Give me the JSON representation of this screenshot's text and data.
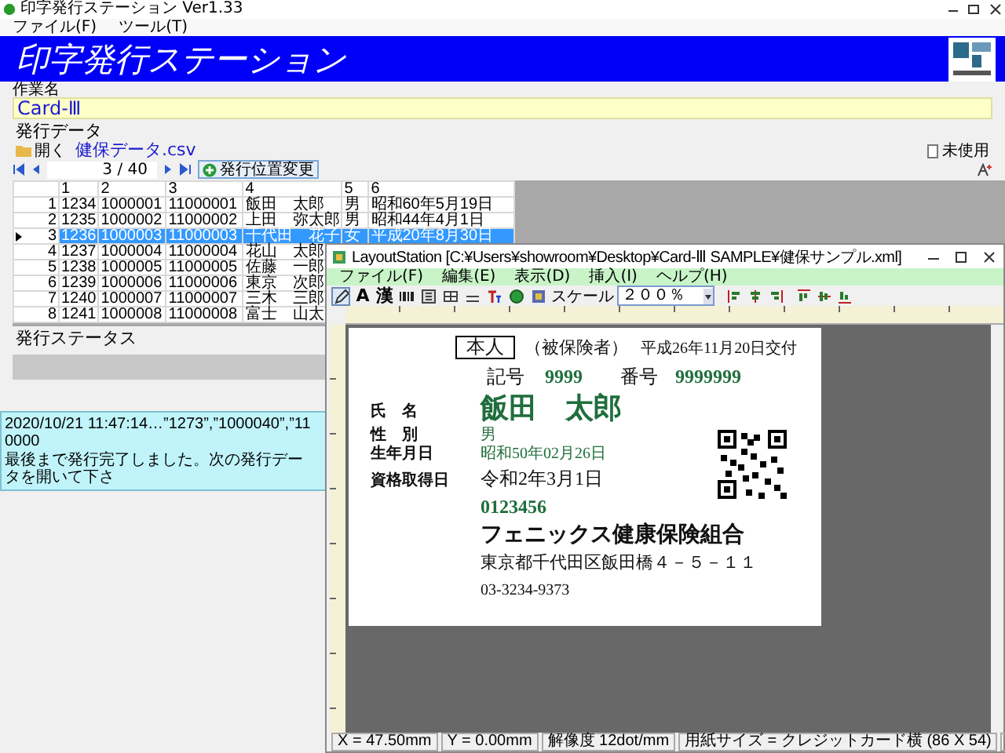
{
  "main_window": {
    "title": "印字発行ステーション Ver1.33",
    "menu": [
      "ファイル(F)",
      "ツール(T)"
    ],
    "banner_title": "印字発行ステーション",
    "job_name": {
      "label": "作業名",
      "value": "Card-Ⅲ"
    },
    "issue_data": {
      "heading": "発行データ",
      "open_button": "開く",
      "file_name": "健保データ.csv",
      "unused_button": "未使用",
      "position": "3 / 40",
      "change_position_button": "発行位置変更"
    },
    "table": {
      "columns": [
        "1",
        "2",
        "3",
        "4",
        "5",
        "6"
      ],
      "rows": [
        {
          "number": "1",
          "cells": [
            "1234",
            "1000001",
            "11000001",
            "飯田　太郎",
            "男",
            "昭和60年5月19日"
          ],
          "selected": false
        },
        {
          "number": "2",
          "cells": [
            "1235",
            "1000002",
            "11000002",
            "上田　弥太郎",
            "男",
            "昭和44年4月1日"
          ],
          "selected": false
        },
        {
          "number": "3",
          "cells": [
            "1236",
            "1000003",
            "11000003",
            "千代田　花子",
            "女",
            "平成20年8月30日"
          ],
          "selected": true
        },
        {
          "number": "4",
          "cells": [
            "1237",
            "1000004",
            "11000004",
            "花山　太郎"
          ],
          "selected": false
        },
        {
          "number": "5",
          "cells": [
            "1238",
            "1000005",
            "11000005",
            "佐藤　一郎"
          ],
          "selected": false
        },
        {
          "number": "6",
          "cells": [
            "1239",
            "1000006",
            "11000006",
            "東京　次郎"
          ],
          "selected": false
        },
        {
          "number": "7",
          "cells": [
            "1240",
            "1000007",
            "11000007",
            "三木　三郎"
          ],
          "selected": false
        },
        {
          "number": "8",
          "cells": [
            "1241",
            "1000008",
            "11000008",
            "富士　山太"
          ],
          "selected": false
        }
      ]
    },
    "issue_status": {
      "heading": "発行ステータス"
    },
    "log": [
      "2020/10/21 11:47:14…”1273”,”1000040”,”110000",
      "最後まで発行完了しました。次の発行データを開いて下さ"
    ]
  },
  "layout_window": {
    "title": "LayoutStation [C:¥Users¥showroom¥Desktop¥Card-Ⅲ SAMPLE¥健保サンプル.xml]",
    "menu": [
      "ファイル(F)",
      "編集(E)",
      "表示(D)",
      "挿入(I)",
      "ヘルプ(H)"
    ],
    "tools": [
      {
        "kind": "pointer",
        "selected": true
      },
      {
        "kind": "glyph",
        "text": "A",
        "selected": false
      },
      {
        "kind": "glyph",
        "text": "漢",
        "selected": false
      },
      {
        "kind": "barcode",
        "selected": false
      },
      {
        "kind": "frame",
        "selected": false
      },
      {
        "kind": "table",
        "selected": false
      },
      {
        "kind": "line",
        "selected": false
      },
      {
        "kind": "textcolor",
        "selected": false
      },
      {
        "kind": "circle",
        "selected": false
      },
      {
        "kind": "picture",
        "selected": false
      }
    ],
    "scale_label": "スケール",
    "scale_value": "２００％",
    "card": {
      "badge": "本人",
      "insured": "（被保険者）",
      "issue_date": "平成26年11月20日交付",
      "symbol_label": "記号",
      "symbol": "9999",
      "number_label": "番号",
      "number": "9999999",
      "name_label": "氏　名",
      "name": "飯田　太郎",
      "gender_label": "性　別",
      "gender": "男",
      "birth_label": "生年月日",
      "birth": "昭和50年02月26日",
      "acquired_label": "資格取得日",
      "acquired": "令和2年3月1日",
      "code": "0123456",
      "insurer": "フェニックス健康保険組合",
      "address": "東京都千代田区飯田橋４－５－１１",
      "phone": "03-3234-9373"
    },
    "status": [
      "X = 47.50mm",
      "Y = 0.00mm",
      "解像度 12dot/mm",
      "用紙サイズ = クレジットカード横 (86 X 54)"
    ]
  }
}
